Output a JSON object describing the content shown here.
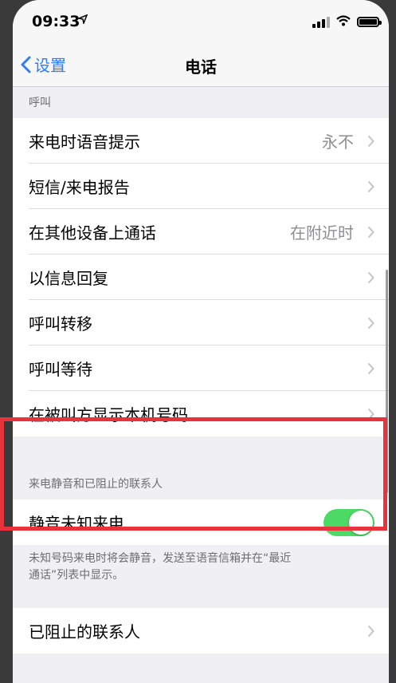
{
  "status": {
    "time": "09:33",
    "location_icon": "location-arrow-icon"
  },
  "nav": {
    "back_label": "设置",
    "title": "电话"
  },
  "section_calling": {
    "header": "呼叫",
    "rows": [
      {
        "label": "来电时语音提示",
        "value": "永不"
      },
      {
        "label": "短信/来电报告",
        "value": ""
      },
      {
        "label": "在其他设备上通话",
        "value": "在附近时"
      },
      {
        "label": "以信息回复",
        "value": ""
      },
      {
        "label": "呼叫转移",
        "value": ""
      },
      {
        "label": "呼叫等待",
        "value": ""
      },
      {
        "label": "在被叫方显示本机号码",
        "value": ""
      }
    ]
  },
  "section_silence": {
    "header": "来电静音和已阻止的联系人",
    "toggle_label": "静音未知来电",
    "toggle_on": true,
    "toggle_color": "#4cd964",
    "footer_line1": "未知号码来电时将会静音，发送至语音信箱并在“最近",
    "footer_line2": "通话”列表中显示。"
  },
  "blocked": {
    "label": "已阻止的联系人"
  },
  "colors": {
    "accent": "#2f7cf6",
    "highlight": "#e8323c"
  }
}
